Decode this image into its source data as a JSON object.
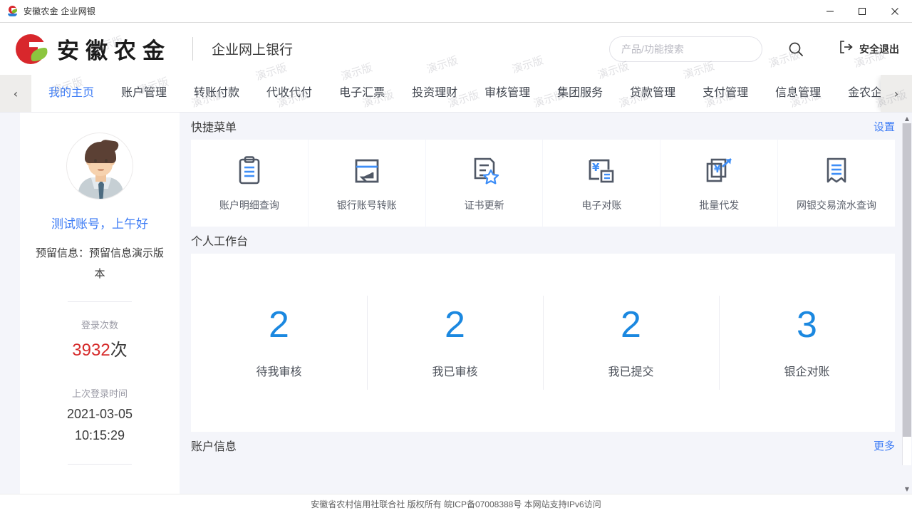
{
  "window": {
    "title": "安徽农金 企业网银",
    "favicon_name": "anhui-nongjin-favicon",
    "minimize": "—",
    "maximize": "☐",
    "close": "✕"
  },
  "header": {
    "logo_text": "安徽农金",
    "sub_title": "企业网上银行",
    "search": {
      "placeholder": "产品/功能搜索",
      "value": ""
    },
    "search_icon": "search-icon",
    "logout_label": "安全退出",
    "logout_icon": "logout-icon"
  },
  "nav": {
    "prev_arrow": "‹",
    "next_arrow": "›",
    "items": [
      {
        "label": "我的主页",
        "active": true
      },
      {
        "label": "账户管理",
        "active": false
      },
      {
        "label": "转账付款",
        "active": false
      },
      {
        "label": "代收代付",
        "active": false
      },
      {
        "label": "电子汇票",
        "active": false
      },
      {
        "label": "投资理财",
        "active": false
      },
      {
        "label": "审核管理",
        "active": false
      },
      {
        "label": "集团服务",
        "active": false
      },
      {
        "label": "贷款管理",
        "active": false
      },
      {
        "label": "支付管理",
        "active": false
      },
      {
        "label": "信息管理",
        "active": false
      },
      {
        "label": "金农企e",
        "active": false
      }
    ]
  },
  "sidebar": {
    "avatar_name": "user-avatar",
    "greeting": "测试账号，上午好",
    "memo": "预留信息：预留信息演示版本",
    "login_count_label": "登录次数",
    "login_count_value": "3932",
    "login_count_unit": "次",
    "last_login_label": "上次登录时间",
    "last_login_date": "2021-03-05",
    "last_login_ime": "10:15:29"
  },
  "quick_menu": {
    "title": "快捷菜单",
    "settings_link": "设置",
    "items": [
      {
        "label": "账户明细查询",
        "icon": "clipboard-list-icon"
      },
      {
        "label": "银行账号转账",
        "icon": "transfer-window-icon"
      },
      {
        "label": "证书更新",
        "icon": "certificate-star-icon"
      },
      {
        "label": "电子对账",
        "icon": "yuan-reconcile-icon"
      },
      {
        "label": "批量代发",
        "icon": "batch-payroll-icon"
      },
      {
        "label": "网银交易流水查询",
        "icon": "receipt-lines-icon"
      }
    ]
  },
  "workbench": {
    "title": "个人工作台",
    "cells": [
      {
        "count": "2",
        "label": "待我审核"
      },
      {
        "count": "2",
        "label": "我已审核"
      },
      {
        "count": "2",
        "label": "我已提交"
      },
      {
        "count": "3",
        "label": "银企对账"
      }
    ]
  },
  "account_info": {
    "title": "账户信息",
    "more_link": "更多"
  },
  "footer": {
    "text": "安徽省农村信用社联合社 版权所有 皖ICP备07008388号 本网站支持IPv6访问"
  },
  "watermark": {
    "text": "演示版"
  },
  "colors": {
    "brand_red": "#d8272c",
    "brand_green": "#8cc63f",
    "link_blue": "#3f7df5",
    "number_blue": "#1b88e0",
    "count_red": "#d62b2b",
    "page_bg": "#f4f5fa"
  }
}
